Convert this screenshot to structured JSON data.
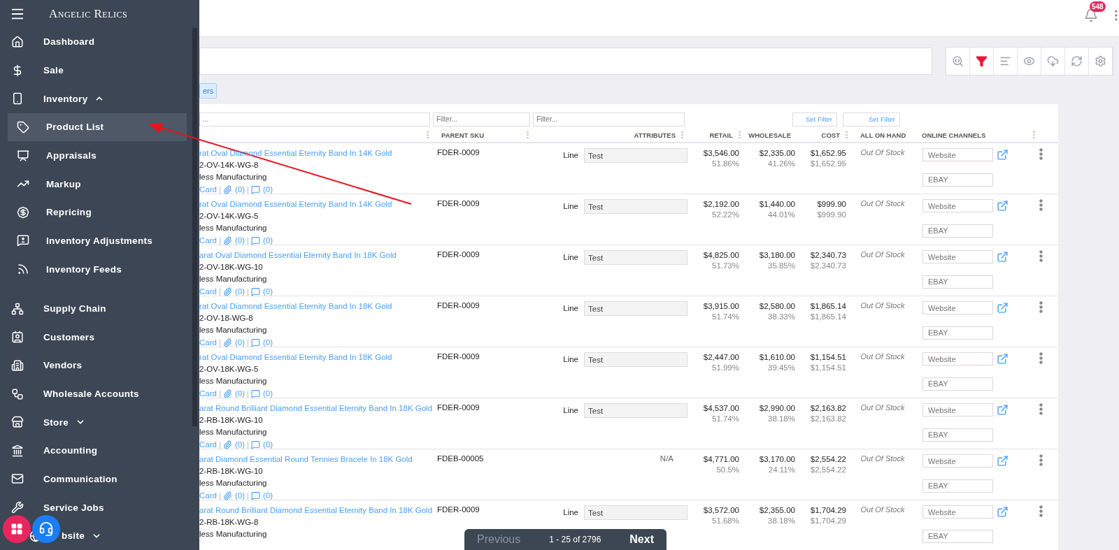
{
  "sidebar": {
    "brand": "Angelic Relics",
    "items": [
      {
        "label": "Dashboard",
        "selected": false
      },
      {
        "label": "Sale",
        "selected": false
      },
      {
        "label": "Inventory",
        "selected": false,
        "expanded": true,
        "children": [
          {
            "label": "Product List",
            "selected": true
          },
          {
            "label": "Appraisals",
            "selected": false
          },
          {
            "label": "Markup",
            "selected": false
          },
          {
            "label": "Repricing",
            "selected": false
          },
          {
            "label": "Inventory Adjustments",
            "selected": false
          },
          {
            "label": "Inventory Feeds",
            "selected": false
          }
        ]
      },
      {
        "label": "Supply Chain",
        "selected": false
      },
      {
        "label": "Customers",
        "selected": false
      },
      {
        "label": "Vendors",
        "selected": false
      },
      {
        "label": "Wholesale Accounts",
        "selected": false
      },
      {
        "label": "Store",
        "selected": false,
        "expanded": false
      },
      {
        "label": "Accounting",
        "selected": false
      },
      {
        "label": "Communication",
        "selected": false
      },
      {
        "label": "Service Jobs",
        "selected": false
      },
      {
        "label": "bsite",
        "selected": false,
        "expanded": false
      }
    ]
  },
  "header": {
    "notifications": "548"
  },
  "toolbar": [
    {
      "kind": "search",
      "selected": false
    },
    {
      "kind": "filter",
      "selected": true
    },
    {
      "kind": "sort",
      "selected": false
    },
    {
      "kind": "view",
      "selected": false
    },
    {
      "kind": "download",
      "selected": false
    },
    {
      "kind": "sync",
      "selected": false
    },
    {
      "kind": "settings",
      "selected": false
    }
  ],
  "chip": "ers",
  "filters": {
    "fields": [
      {
        "placeholder": "..."
      },
      {
        "placeholder": "Filter..."
      },
      {
        "placeholder": "Filter..."
      }
    ],
    "set_buttons": [
      "Set Filter",
      "Set Filter"
    ]
  },
  "table": {
    "columns": [
      "PARENT SKU",
      "ATTRIBUTES",
      "RETAIL",
      "WHOLESALE",
      "COST",
      "ALL ON HAND",
      "ONLINE CHANNELS"
    ],
    "rows": [
      {
        "title": "rat Oval Diamond Essential Eternity Band In 14K Gold",
        "sku": "2-OV-14K-WG-8",
        "vendor": "less Manufacturing",
        "links": {
          "card": "Card",
          "files": "(0)",
          "notes": "(0)"
        },
        "parent_sku": "FDER-0009",
        "attribute": {
          "kind": "line",
          "label": "Line",
          "value": "Test"
        },
        "retail": "$3,546.00",
        "retail_pct": "51.86%",
        "wholesale": "$2,335.00",
        "wholesale_pct": "41.26%",
        "cost": "$1,652.95",
        "cost_sub": "$1,652.95",
        "on_hand": "Out Of Stock",
        "channel_placeholders": [
          "Website",
          "EBAY"
        ]
      },
      {
        "title": "rat Oval Diamond Essential Eternity Band In 14K Gold",
        "sku": "2-OV-14K-WG-5",
        "vendor": "less Manufacturing",
        "links": {
          "card": "Card",
          "files": "(0)",
          "notes": "(0)"
        },
        "parent_sku": "FDER-0009",
        "attribute": {
          "kind": "line",
          "label": "Line",
          "value": "Test"
        },
        "retail": "$2,192.00",
        "retail_pct": "52.22%",
        "wholesale": "$1,440.00",
        "wholesale_pct": "44.01%",
        "cost": "$999.90",
        "cost_sub": "$999.90",
        "on_hand": "Out Of Stock",
        "channel_placeholders": [
          "Website",
          "EBAY"
        ]
      },
      {
        "title": "arat Oval Diamond Essential Eternity Band In 18K Gold",
        "sku": "2-OV-18K-WG-10",
        "vendor": "less Manufacturing",
        "links": {
          "card": "Card",
          "files": "(0)",
          "notes": "(0)"
        },
        "parent_sku": "FDER-0009",
        "attribute": {
          "kind": "line",
          "label": "Line",
          "value": "Test"
        },
        "retail": "$4,825.00",
        "retail_pct": "51.73%",
        "wholesale": "$3,180.00",
        "wholesale_pct": "35.85%",
        "cost": "$2,340.73",
        "cost_sub": "$2,340.73",
        "on_hand": "Out Of Stock",
        "channel_placeholders": [
          "Website",
          "EBAY"
        ]
      },
      {
        "title": "rat Oval Diamond Essential Eternity Band In 18K Gold",
        "sku": "2-OV-18-WG-8",
        "vendor": "less Manufacturing",
        "links": {
          "card": "Card",
          "files": "(0)",
          "notes": "(0)"
        },
        "parent_sku": "FDER-0009",
        "attribute": {
          "kind": "line",
          "label": "Line",
          "value": "Test"
        },
        "retail": "$3,915.00",
        "retail_pct": "51.74%",
        "wholesale": "$2,580.00",
        "wholesale_pct": "38.33%",
        "cost": "$1,865.14",
        "cost_sub": "$1,865.14",
        "on_hand": "Out Of Stock",
        "channel_placeholders": [
          "Website",
          "EBAY"
        ]
      },
      {
        "title": "rat Oval Diamond Essential Eternity Band In 18K Gold",
        "sku": "2-OV-18K-WG-5",
        "vendor": "less Manufacturing",
        "links": {
          "card": "Card",
          "files": "(0)",
          "notes": "(0)"
        },
        "parent_sku": "FDER-0009",
        "attribute": {
          "kind": "line",
          "label": "Line",
          "value": "Test"
        },
        "retail": "$2,447.00",
        "retail_pct": "51.99%",
        "wholesale": "$1,610.00",
        "wholesale_pct": "39.45%",
        "cost": "$1,154.51",
        "cost_sub": "$1,154.51",
        "on_hand": "Out Of Stock",
        "channel_placeholders": [
          "Website",
          "EBAY"
        ]
      },
      {
        "title": "arat Round Brilliant Diamond Essential Eternity Band In 18K Gold",
        "sku": "2-RB-18K-WG-10",
        "vendor": "less Manufacturing",
        "links": {
          "card": "Card",
          "files": "(0)",
          "notes": "(0)"
        },
        "parent_sku": "FDER-0009",
        "attribute": {
          "kind": "line",
          "label": "Line",
          "value": "Test"
        },
        "retail": "$4,537.00",
        "retail_pct": "51.74%",
        "wholesale": "$2,990.00",
        "wholesale_pct": "38.18%",
        "cost": "$2,163.82",
        "cost_sub": "$2,163.82",
        "on_hand": "Out Of Stock",
        "channel_placeholders": [
          "Website",
          "EBAY"
        ]
      },
      {
        "title": "arat Diamond Essential Round Tennies Bracele In 18K Gold",
        "sku": "2-RB-18K-WG-10",
        "vendor": "less Manufacturing",
        "links": {
          "card": "Card",
          "files": "(0)",
          "notes": "(0)"
        },
        "parent_sku": "FDEB-00005",
        "attribute": {
          "kind": "na",
          "label": "N/A"
        },
        "retail": "$4,771.00",
        "retail_pct": "50.5%",
        "wholesale": "$3,170.00",
        "wholesale_pct": "24.11%",
        "cost": "$2,554.22",
        "cost_sub": "$2,554.22",
        "on_hand": "Out Of Stock",
        "channel_placeholders": [
          "Website",
          "EBAY"
        ]
      },
      {
        "title": "arat Round Brilliant Diamond Essential Eternity Band In 18K Gold",
        "sku": "2-RB-18K-WG-8",
        "vendor": "less Manufacturing",
        "parent_sku": "FDER-0009",
        "attribute": {
          "kind": "line",
          "label": "Line",
          "value": "Test"
        },
        "retail": "$3,572.00",
        "retail_pct": "51.68%",
        "wholesale": "$2,355.00",
        "wholesale_pct": "38.18%",
        "cost": "$1,704.29",
        "cost_sub": "$1,704.29",
        "on_hand": "Out Of Stock",
        "channel_placeholders": [
          "Website",
          "EBAY"
        ]
      }
    ]
  },
  "pagination": {
    "previous": "Previous",
    "range": "1 - 25 of 2796",
    "next": "Next"
  }
}
